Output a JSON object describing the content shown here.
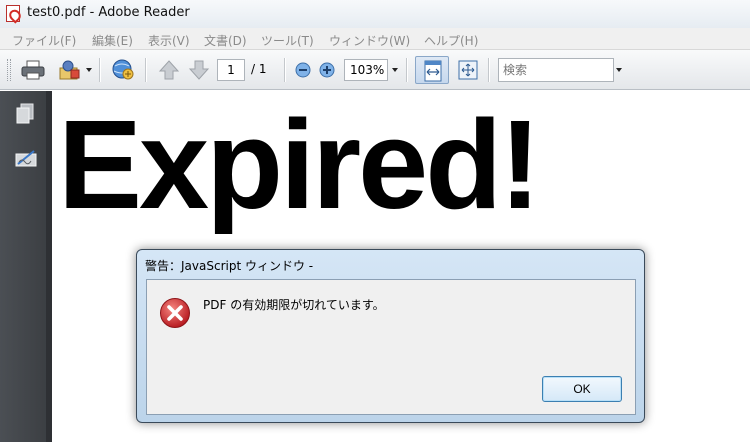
{
  "window": {
    "title": "test0.pdf - Adobe Reader",
    "icon": "pdf-file-icon"
  },
  "menubar": {
    "items": [
      "ファイル(F)",
      "編集(E)",
      "表示(V)",
      "文書(D)",
      "ツール(T)",
      "ウィンドウ(W)",
      "ヘルプ(H)"
    ],
    "enabled": false
  },
  "toolbar": {
    "page_current": "1",
    "page_total": "/ 1",
    "zoom": "103%",
    "search_placeholder": "検索",
    "icons": [
      "printer-icon",
      "email-attach-icon",
      "collaborate-globe-icon",
      "previous-page-icon",
      "next-page-icon",
      "zoom-out-icon",
      "zoom-in-icon",
      "fit-width-icon",
      "full-screen-icon"
    ]
  },
  "navpanel": {
    "icons": [
      "pages-icon",
      "signature-icon"
    ]
  },
  "document": {
    "heading": "Expired!"
  },
  "dialog": {
    "title": "警告：JavaScript ウィンドウ -",
    "message": "PDF の有効期限が切れています。",
    "icon": "error-icon",
    "ok_label": "OK"
  },
  "colors": {
    "error": "#c8262c",
    "dialog_frame": "#bcd4ea",
    "nav_panel": "#43474c"
  }
}
